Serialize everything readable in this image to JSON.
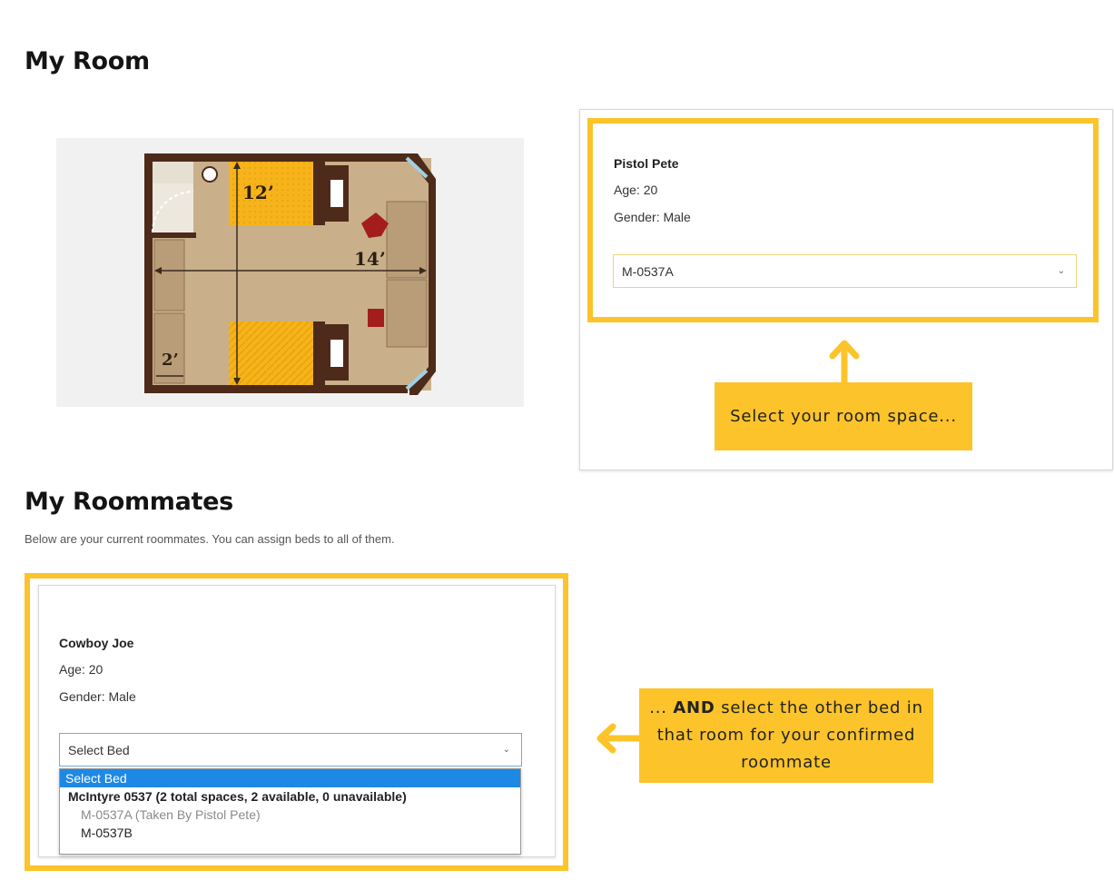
{
  "my_room": {
    "heading": "My Room"
  },
  "room_card": {
    "name": "Pistol Pete",
    "age": "Age: 20",
    "gender": "Gender: Male",
    "select_value": "M-0537A"
  },
  "floorplan": {
    "dim_length": "12’",
    "dim_width": "14’",
    "dim_closet": "2’"
  },
  "callouts": {
    "room_space": "Select your room space...",
    "roommate_prefix": "...",
    "roommate_bold": "AND",
    "roommate_rest": "select the other bed in that room for your confirmed roommate"
  },
  "my_roommates": {
    "heading": "My Roommates",
    "description": "Below are your current roommates. You can assign beds to all of them."
  },
  "roommate_card": {
    "name": "Cowboy Joe",
    "age": "Age: 20",
    "gender": "Gender: Male",
    "select_value": "Select Bed",
    "options": [
      "Select Bed",
      "McIntyre 0537 (2 total spaces, 2 available, 0 unavailable)",
      "M-0537A (Taken By Pistol Pete)",
      "M-0537B"
    ]
  },
  "colors": {
    "highlight": "#fcc42a",
    "selected_option": "#1e88e5",
    "floor": "#c9b08a",
    "wall": "#4e2a1a",
    "bed": "#f6b41a"
  }
}
